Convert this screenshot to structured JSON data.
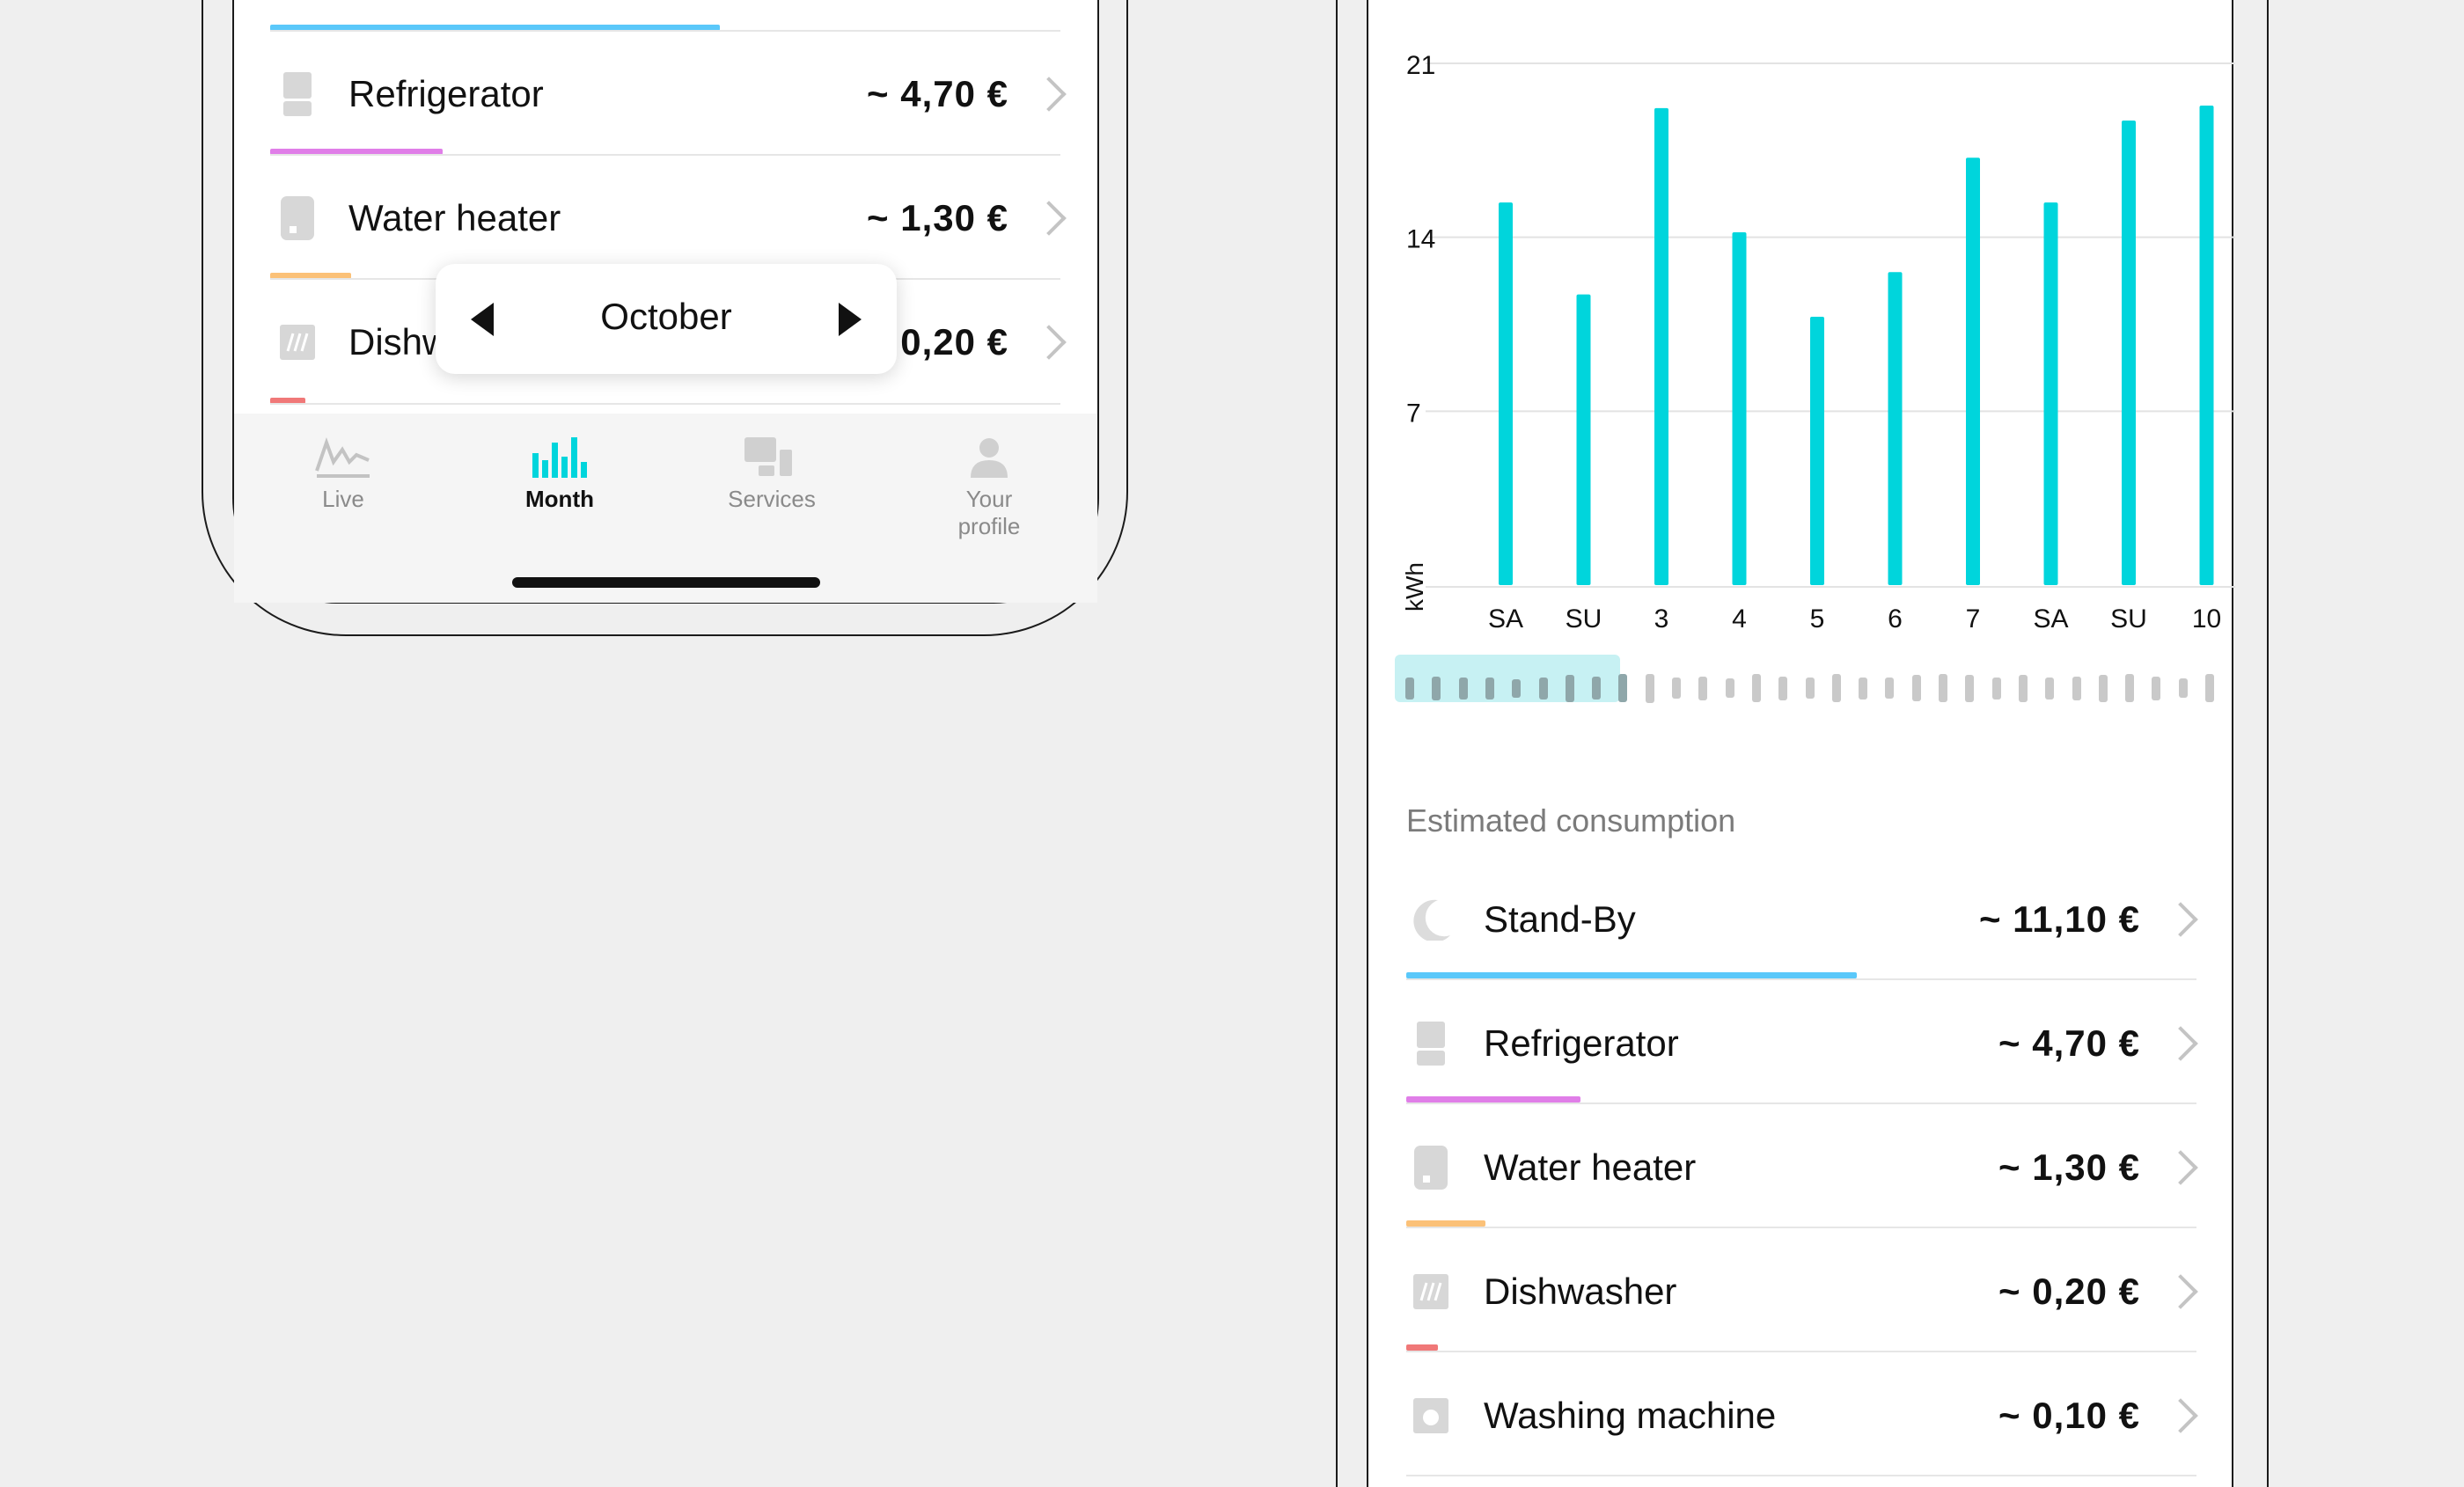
{
  "left_phone": {
    "rows": [
      {
        "label": "Refrigerator",
        "price": "~ 4,70 €",
        "icon": "refrigerator-icon"
      },
      {
        "label": "Water heater",
        "price": "~ 1,30 €",
        "icon": "water-heater-icon"
      },
      {
        "label": "Dishw",
        "price": "0,20 €",
        "icon": "dishwasher-icon"
      }
    ],
    "month_picker": {
      "label": "October"
    },
    "tabs": [
      {
        "label": "Live",
        "icon": "live-graph-icon"
      },
      {
        "label": "Month",
        "icon": "month-bars-icon",
        "active": true
      },
      {
        "label": "Services",
        "icon": "services-icon"
      },
      {
        "label_line1": "Your",
        "label_line2": "profile",
        "icon": "profile-icon"
      }
    ]
  },
  "right_phone": {
    "chart_data": {
      "type": "bar",
      "categories": [
        "SA",
        "SU",
        "3",
        "4",
        "5",
        "6",
        "7",
        "SA",
        "SU",
        "10"
      ],
      "values": [
        15.4,
        11.7,
        19.2,
        14.2,
        10.8,
        12.6,
        17.2,
        15.4,
        18.7,
        19.3
      ],
      "yticks": [
        7,
        14,
        21
      ],
      "ylim": [
        0,
        21
      ],
      "ylabel": "kWh",
      "color": "#00d5dc",
      "grid": true
    },
    "scrubber_values": [
      0.45,
      0.55,
      0.45,
      0.45,
      0.3,
      0.45,
      0.7,
      0.5,
      0.75,
      0.8,
      0.4,
      0.55,
      0.35,
      0.75,
      0.55,
      0.4,
      0.75,
      0.45,
      0.4,
      0.65,
      0.75,
      0.7,
      0.45,
      0.7,
      0.45,
      0.55,
      0.7,
      0.75,
      0.55,
      0.35,
      0.75
    ],
    "section_title": "Estimated consumption",
    "rows": [
      {
        "label": "Stand-By",
        "price": "~ 11,10 €",
        "icon": "moon-icon",
        "bar_color": "#5ac8fa",
        "bar_fraction": 0.57
      },
      {
        "label": "Refrigerator",
        "price": "~ 4,70 €",
        "icon": "refrigerator-icon",
        "bar_color": "#e07ee8",
        "bar_fraction": 0.22
      },
      {
        "label": "Water heater",
        "price": "~ 1,30 €",
        "icon": "water-heater-icon",
        "bar_color": "#fbc178",
        "bar_fraction": 0.1
      },
      {
        "label": "Dishwasher",
        "price": "~ 0,20 €",
        "icon": "dishwasher-icon",
        "bar_color": "#f07878",
        "bar_fraction": 0.04
      },
      {
        "label": "Washing machine",
        "price": "~ 0,10 €",
        "icon": "washing-machine-icon"
      }
    ]
  },
  "colors": {
    "accent": "#00d5dc",
    "standby": "#5ac8fa",
    "refrigerator": "#e07ee8",
    "water_heater": "#fbc178",
    "dishwasher": "#f07878"
  }
}
